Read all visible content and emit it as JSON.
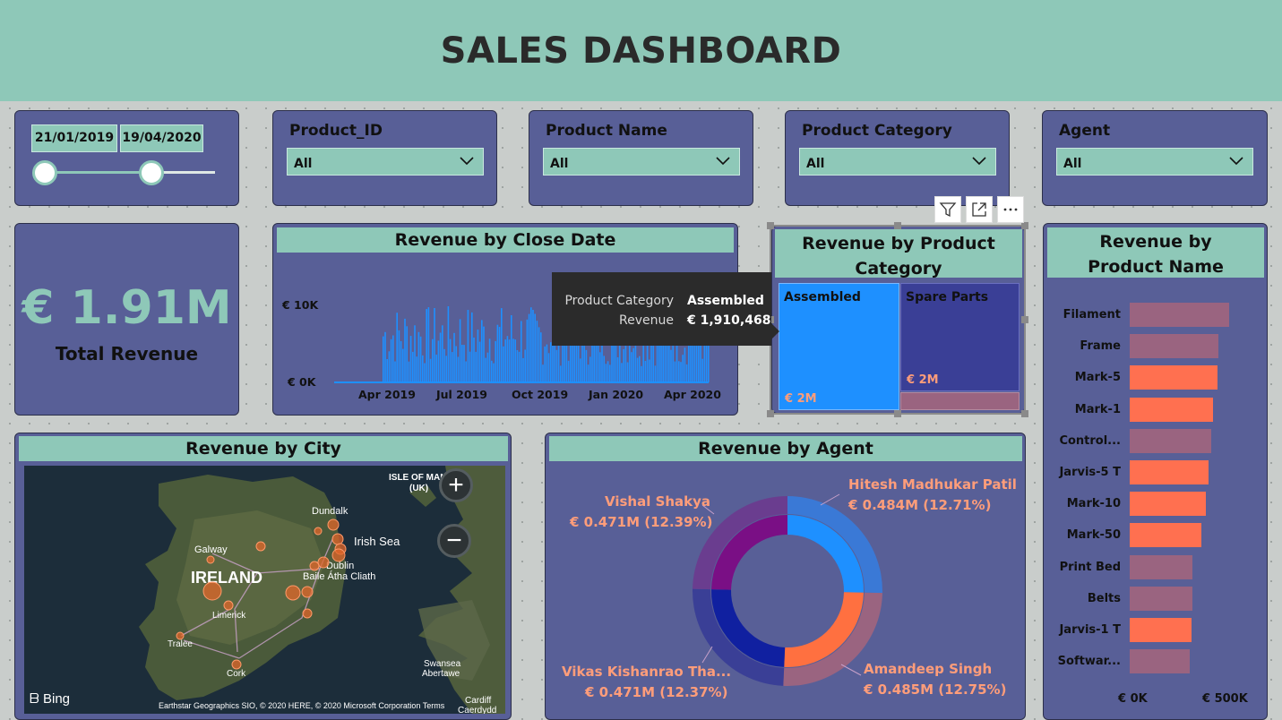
{
  "header": {
    "title": "SALES DASHBOARD"
  },
  "colors": {
    "header_bg": "#8ec8b8",
    "card_bg": "#585f97",
    "accent_teal": "#8ec8b8",
    "bar_orange": "#ff7050",
    "bar_muted": "#9a6480",
    "series_blue": "#1e90ff",
    "label_orange": "#ff9d7a"
  },
  "date_slicer": {
    "start": "21/01/2019",
    "end": "19/04/2020",
    "start_fraction": 0.0,
    "end_fraction": 0.63
  },
  "slicers": [
    {
      "label": "Product_ID",
      "value": "All"
    },
    {
      "label": "Product Name",
      "value": "All"
    },
    {
      "label": "Product Category",
      "value": "All"
    },
    {
      "label": "Agent",
      "value": "All"
    }
  ],
  "kpi": {
    "value": "€ 1.91M",
    "label": "Total Revenue"
  },
  "revenue_by_close_date": {
    "title": "Revenue by Close Date",
    "y_ticks": [
      "€ 10K",
      "€ 0K"
    ],
    "x_ticks": [
      "Apr 2019",
      "Jul 2019",
      "Oct 2019",
      "Jan 2020",
      "Apr 2020"
    ]
  },
  "tooltip": {
    "rows": [
      {
        "key": "Product Category",
        "value": "Assembled"
      },
      {
        "key": "Revenue",
        "value": "€ 1,910,468"
      }
    ]
  },
  "toolbar": {
    "filter_icon": "filter-icon",
    "focus_icon": "focus-mode-icon",
    "more_icon": "more-options-icon"
  },
  "revenue_by_product_category": {
    "title": "Revenue by Product Category",
    "tiles": [
      {
        "name": "Assembled",
        "value": "€ 2M",
        "color": "#1e90ff"
      },
      {
        "name": "Spare Parts",
        "value": "€ 2M",
        "color": "#3a3f96"
      }
    ]
  },
  "revenue_by_product_name": {
    "title": "Revenue by Product Name",
    "x_ticks": [
      "€ 0K",
      "€ 500K"
    ]
  },
  "revenue_by_city": {
    "title": "Revenue by City",
    "labels": {
      "isle_of_man": "ISLE OF MAN",
      "uk": "(UK)",
      "dundalk": "Dundalk",
      "irish_sea": "Irish Sea",
      "galway": "Galway",
      "ireland": "IRELAND",
      "dublin": "Dublin",
      "baile": "Baile Átha Cliath",
      "limerick": "Limerick",
      "tralee": "Tralee",
      "cork": "Cork",
      "swansea": "Swansea",
      "abertawe": "Abertawe",
      "cardiff": "Cardiff",
      "caerdydd": "Caerdydd"
    },
    "zoom_in": "+",
    "zoom_out": "−",
    "bing": "Bing",
    "copyright": "Earthstar Geographics SIO, © 2020 HERE, © 2020 Microsoft Corporation",
    "terms": "Terms"
  },
  "revenue_by_agent": {
    "title": "Revenue by Agent",
    "agents": [
      {
        "name": "Hitesh Madhukar Patil",
        "value": "€ 0.484M (12.71%)"
      },
      {
        "name": "Amandeep Singh",
        "value": "€ 0.485M (12.75%)"
      },
      {
        "name": "Vikas Kishanrao Tha...",
        "value": "€ 0.471M (12.37%)"
      },
      {
        "name": "Vishal Shakya",
        "value": "€ 0.471M (12.39%)"
      }
    ]
  },
  "chart_data": [
    {
      "type": "area",
      "title": "Revenue by Close Date",
      "x_range": [
        "2019-01-21",
        "2020-04-19"
      ],
      "x_ticks": [
        "Apr 2019",
        "Jul 2019",
        "Oct 2019",
        "Jan 2020",
        "Apr 2020"
      ],
      "y_ticks": [
        "€ 0K",
        "€ 10K"
      ],
      "ylim": [
        0,
        12000
      ],
      "series": [
        {
          "x": [
            "2019-03-31",
            "2020-04-05"
          ],
          "values": [
            5000,
            5000
          ]
        }
      ]
    },
    {
      "type": "heatmap",
      "title": "Revenue by Product Category",
      "categories": [
        "Assembled",
        "Spare Parts"
      ],
      "values": [
        1910468,
        1900000
      ],
      "data_labels": [
        "€ 2M",
        "€ 2M"
      ]
    },
    {
      "type": "bar",
      "title": "Revenue by Product Name",
      "categories": [
        "Filament",
        "Frame",
        "Mark-5",
        "Mark-1",
        "Control...",
        "Jarvis-5 T",
        "Mark-10",
        "Mark-50",
        "Print Bed",
        "Belts",
        "Jarvis-1 T",
        "Softwar..."
      ],
      "values": [
        350000,
        312000,
        310000,
        293000,
        288000,
        278000,
        268000,
        253000,
        222000,
        220000,
        217000,
        212000
      ],
      "highlight": [
        false,
        false,
        true,
        true,
        false,
        true,
        true,
        true,
        false,
        false,
        true,
        false
      ],
      "xlim": [
        0,
        600000
      ],
      "x_ticks": [
        "€ 0K",
        "€ 500K"
      ]
    },
    {
      "type": "pie",
      "title": "Revenue by Agent",
      "categories": [
        "Hitesh Madhukar Patil",
        "Amandeep Singh",
        "Vikas Kishanrao Tha...",
        "Vishal Shakya"
      ],
      "values": [
        0.484,
        0.485,
        0.471,
        0.471
      ],
      "percent": [
        12.71,
        12.75,
        12.37,
        12.39
      ]
    }
  ]
}
